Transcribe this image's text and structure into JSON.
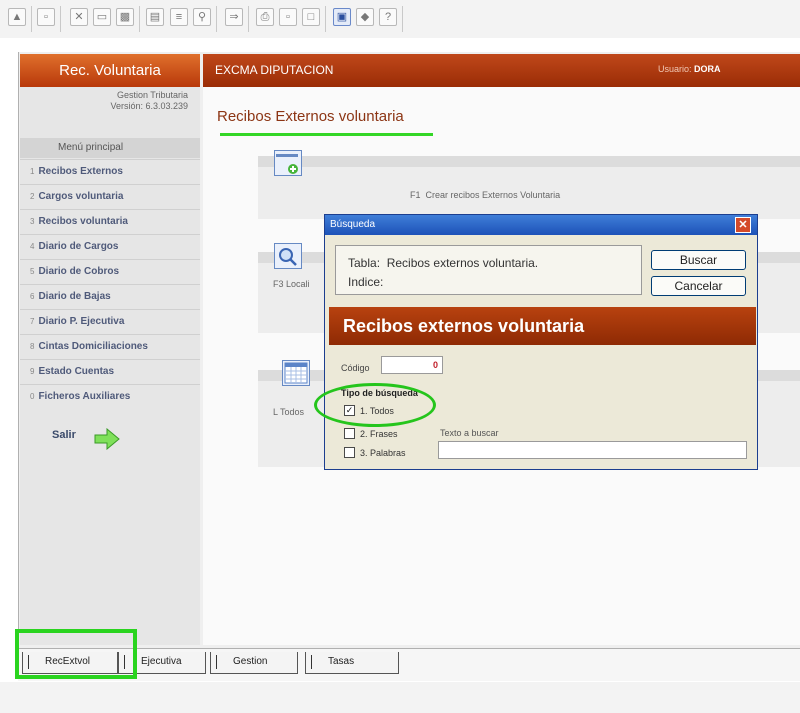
{
  "toolbar": {
    "buttons": [
      "open-icon",
      "copy-doc-icon",
      "cut-icon",
      "copy-icon",
      "paste-icon",
      "window-icon",
      "find-replace-icon",
      "search-icon",
      "export-icon",
      "print-icon",
      "preview-icon",
      "page-icon",
      "monitor-icon",
      "eraser-icon",
      "help-icon"
    ]
  },
  "sidebar": {
    "app_name": "Rec. Voluntaria",
    "gestion_label": "Gestion Tributaria",
    "version": "Versión: 6.3.03.239",
    "menu_title": "Menú principal",
    "items": [
      {
        "num": "1",
        "label": "Recibos Externos"
      },
      {
        "num": "2",
        "label": "Cargos voluntaria"
      },
      {
        "num": "3",
        "label": "Recibos voluntaria"
      },
      {
        "num": "4",
        "label": "Diario de Cargos"
      },
      {
        "num": "5",
        "label": "Diario de Cobros"
      },
      {
        "num": "6",
        "label": "Diario de Bajas"
      },
      {
        "num": "7",
        "label": "Diario P. Ejecutiva"
      },
      {
        "num": "8",
        "label": "Cintas Domiciliaciones"
      },
      {
        "num": "9",
        "label": "Estado Cuentas"
      },
      {
        "num": "0",
        "label": "Ficheros Auxiliares"
      }
    ],
    "salir_label": "Salir"
  },
  "header": {
    "title": "EXCMA DIPUTACION",
    "user_prefix": "Usuario:",
    "user_name": "DORA"
  },
  "main": {
    "section_title": "Recibos Externos voluntaria",
    "cards": [
      {
        "key": "F1",
        "text": "Crear recibos Externos Voluntaria"
      },
      {
        "key": "F3",
        "text": "Locali"
      },
      {
        "key": "L",
        "text": "Todos"
      }
    ]
  },
  "dialog": {
    "title": "Búsqueda",
    "tabla_label": "Tabla:",
    "tabla_value": "Recibos externos voluntaria.",
    "indice_label": "Indice:",
    "buscar_label": "Buscar",
    "cancelar_label": "Cancelar",
    "banner": "Recibos externos voluntaria",
    "codigo_label": "Código",
    "codigo_value": "0",
    "tipo_label": "Tipo de búsqueda",
    "options": [
      {
        "label": "1. Todos",
        "checked": true
      },
      {
        "label": "2. Frases",
        "checked": false
      },
      {
        "label": "3. Palabras",
        "checked": false
      }
    ],
    "texto_label": "Texto a buscar",
    "texto_value": ""
  },
  "taskbar": {
    "tabs": [
      "RecExtvol",
      "Ejecutiva",
      "Gestion",
      "Tasas"
    ]
  },
  "colors": {
    "accent_orange": "#c0481a",
    "highlight_green": "#2ad41f",
    "dialog_titlebar": "#1d52b8"
  }
}
